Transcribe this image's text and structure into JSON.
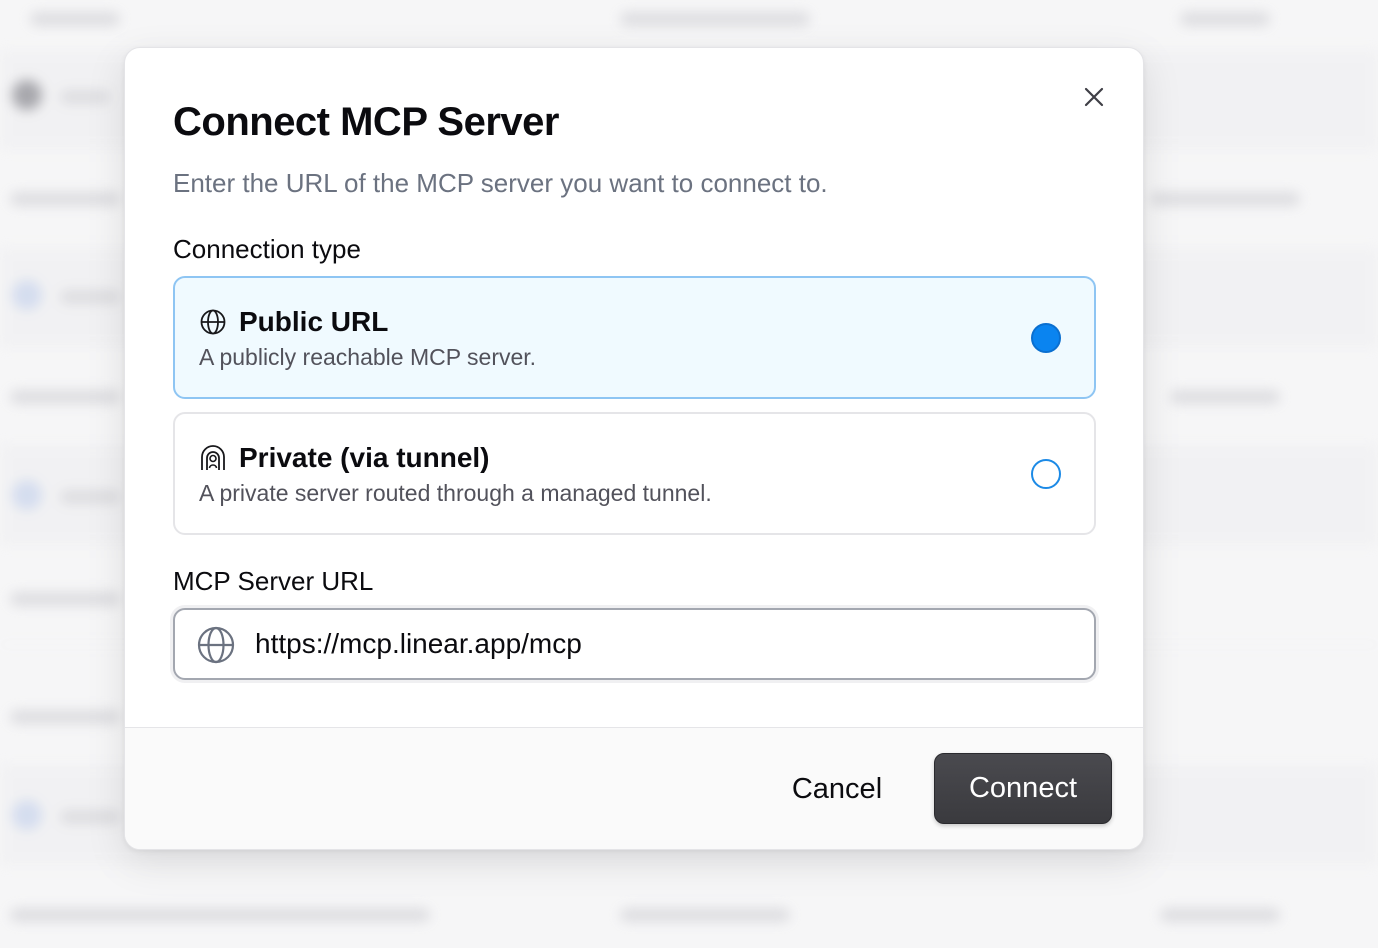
{
  "dialog": {
    "title": "Connect MCP Server",
    "subtitle": "Enter the URL of the MCP server you want to connect to.",
    "connection_type_label": "Connection type",
    "options": [
      {
        "icon": "globe-icon",
        "title": "Public URL",
        "description": "A publicly reachable MCP server.",
        "selected": true
      },
      {
        "icon": "tunnel-icon",
        "title": "Private (via tunnel)",
        "description": "A private server routed through a managed tunnel.",
        "selected": false
      }
    ],
    "url_label": "MCP Server URL",
    "url_value": "https://mcp.linear.app/mcp",
    "cancel_label": "Cancel",
    "connect_label": "Connect"
  },
  "colors": {
    "selected_bg": "#f0faff",
    "selected_border": "#8ec5f3",
    "radio_accent": "#0a84f0",
    "primary_button": "#3f3f43"
  }
}
